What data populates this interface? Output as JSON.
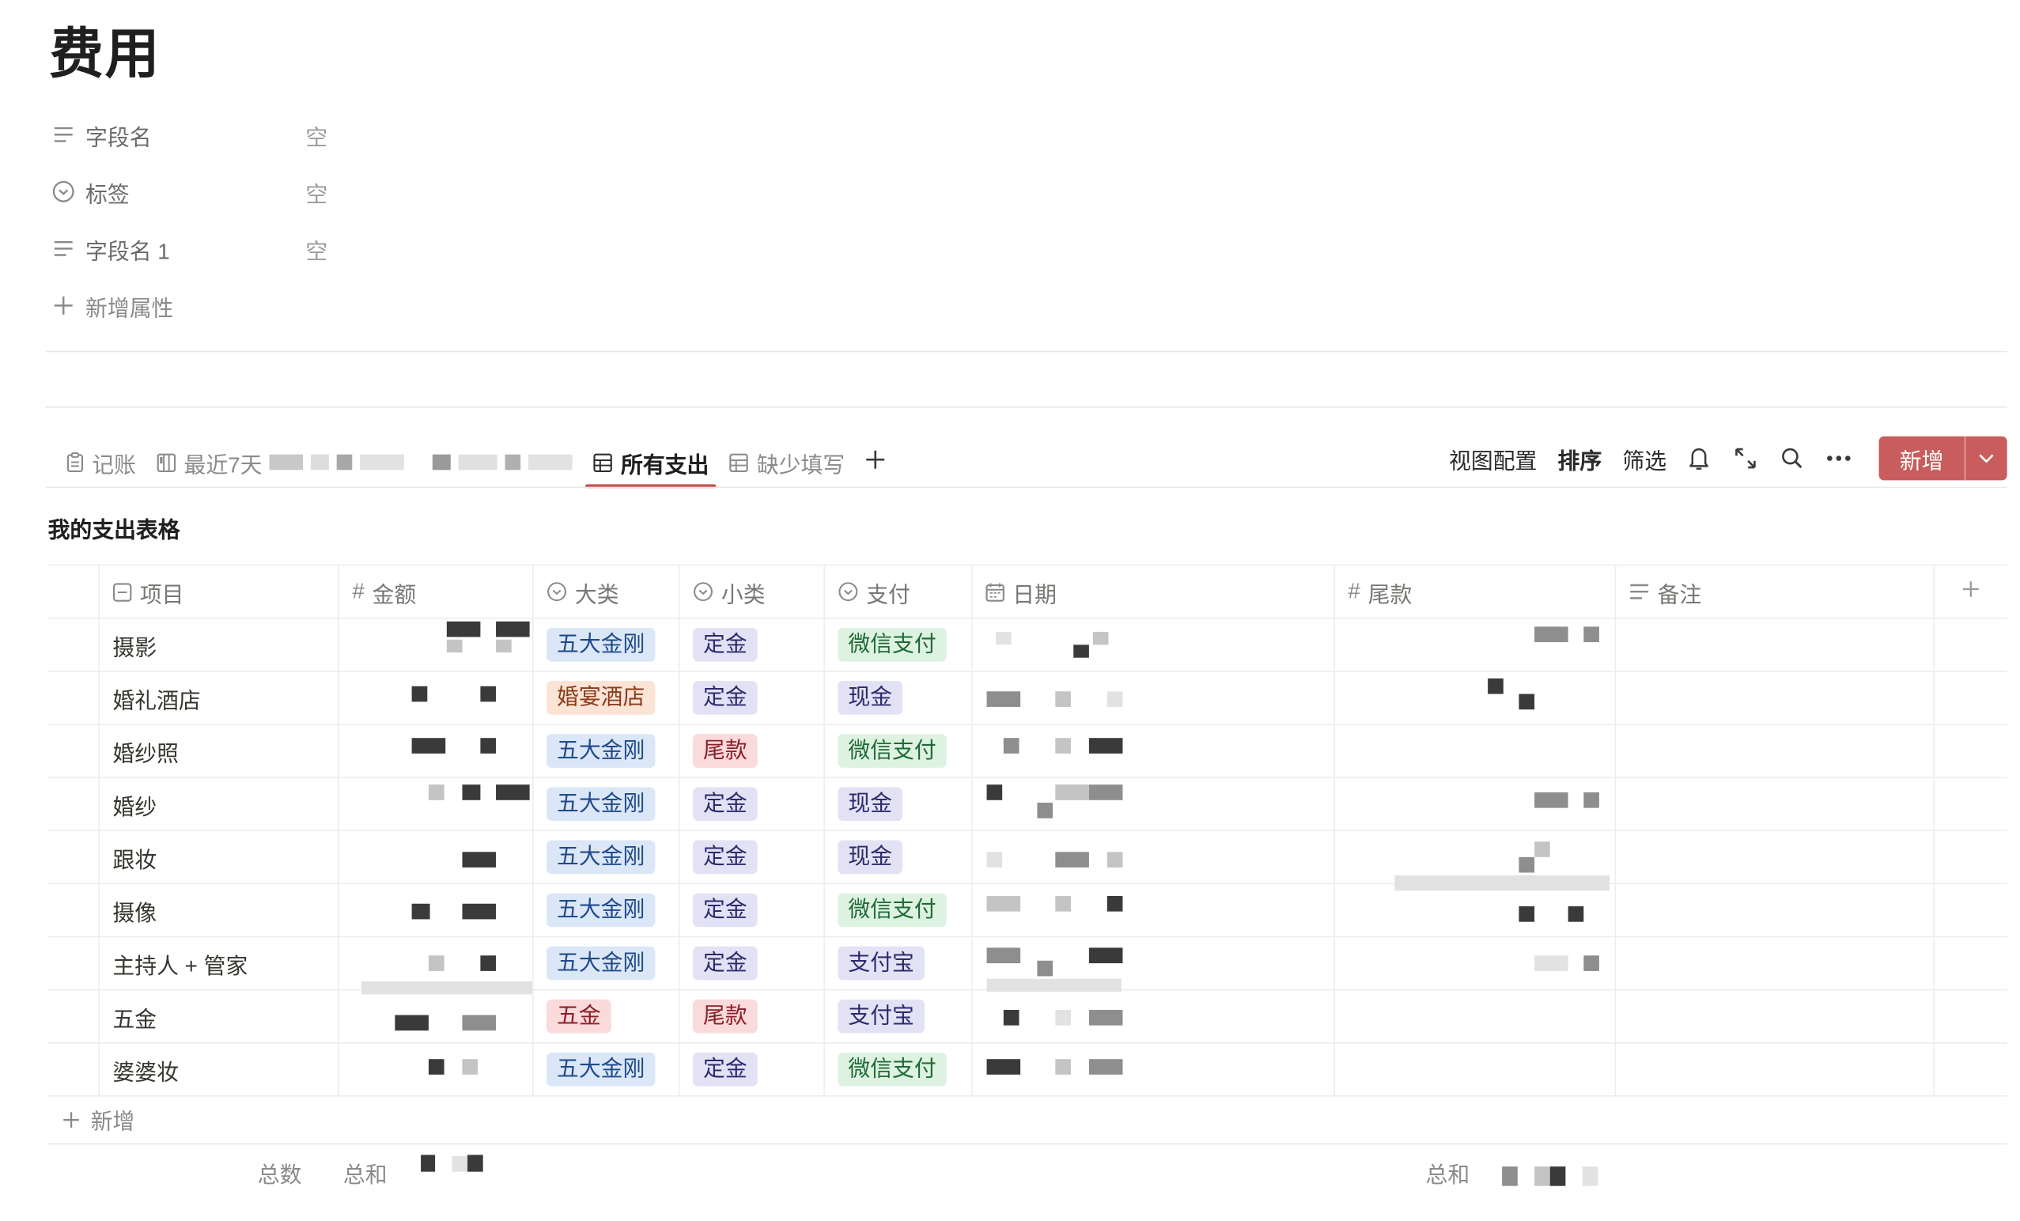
{
  "page": {
    "title": "费用"
  },
  "properties": [
    {
      "icon": "text-lines-icon",
      "name": "字段名",
      "value": "空"
    },
    {
      "icon": "select-circle-icon",
      "name": "标签",
      "value": "空"
    },
    {
      "icon": "text-lines-icon",
      "name": "字段名 1",
      "value": "空"
    }
  ],
  "add_property_label": "新增属性",
  "tabs": [
    {
      "label": "记账",
      "icon": "clipboard-icon",
      "active": false
    },
    {
      "label": "最近7天",
      "icon": "board-icon",
      "active": false
    },
    {
      "label": "所有支出",
      "icon": "table-icon",
      "active": true
    },
    {
      "label": "缺少填写",
      "icon": "table-icon",
      "active": false
    }
  ],
  "toolbar": {
    "view_config": "视图配置",
    "sort": "排序",
    "filter": "筛选",
    "new_label": "新增"
  },
  "view": {
    "title": "我的支出表格"
  },
  "columns": [
    {
      "label": "项目",
      "icon": "checkbox-square-icon"
    },
    {
      "label": "金额",
      "icon": "hash-icon"
    },
    {
      "label": "大类",
      "icon": "select-circle-icon"
    },
    {
      "label": "小类",
      "icon": "select-circle-icon"
    },
    {
      "label": "支付",
      "icon": "select-circle-icon"
    },
    {
      "label": "日期",
      "icon": "calendar-icon"
    },
    {
      "label": "尾款",
      "icon": "hash-icon"
    },
    {
      "label": "备注",
      "icon": "text-lines-icon"
    }
  ],
  "tag_colors": {
    "blue": {
      "bg": "#dbe7f7",
      "fg": "#1f4a8a"
    },
    "orange": {
      "bg": "#fbe4d6",
      "fg": "#8a3d1a"
    },
    "red": {
      "bg": "#fadada",
      "fg": "#8a1f2a"
    },
    "green": {
      "bg": "#def2e2",
      "fg": "#1f6a35"
    },
    "purple": {
      "bg": "#e3e2f5",
      "fg": "#2b2a6b"
    }
  },
  "rows": [
    {
      "item": "摄影",
      "category": "五大金刚",
      "category_color": "blue",
      "sub": "定金",
      "sub_color": "purple",
      "pay": "微信支付",
      "pay_color": "green"
    },
    {
      "item": "婚礼酒店",
      "category": "婚宴酒店",
      "category_color": "orange",
      "sub": "定金",
      "sub_color": "purple",
      "pay": "现金",
      "pay_color": "purple"
    },
    {
      "item": "婚纱照",
      "category": "五大金刚",
      "category_color": "blue",
      "sub": "尾款",
      "sub_color": "red",
      "pay": "微信支付",
      "pay_color": "green"
    },
    {
      "item": "婚纱",
      "category": "五大金刚",
      "category_color": "blue",
      "sub": "定金",
      "sub_color": "purple",
      "pay": "现金",
      "pay_color": "purple"
    },
    {
      "item": "跟妆",
      "category": "五大金刚",
      "category_color": "blue",
      "sub": "定金",
      "sub_color": "purple",
      "pay": "现金",
      "pay_color": "purple"
    },
    {
      "item": "摄像",
      "category": "五大金刚",
      "category_color": "blue",
      "sub": "定金",
      "sub_color": "purple",
      "pay": "微信支付",
      "pay_color": "green"
    },
    {
      "item": "主持人 + 管家",
      "category": "五大金刚",
      "category_color": "blue",
      "sub": "定金",
      "sub_color": "purple",
      "pay": "支付宝",
      "pay_color": "purple"
    },
    {
      "item": "五金",
      "category": "五金",
      "category_color": "red",
      "sub": "尾款",
      "sub_color": "red",
      "pay": "支付宝",
      "pay_color": "purple"
    },
    {
      "item": "婆婆妆",
      "category": "五大金刚",
      "category_color": "blue",
      "sub": "定金",
      "sub_color": "purple",
      "pay": "微信支付",
      "pay_color": "green"
    }
  ],
  "add_row_label": "新增",
  "footer": {
    "count_label": "总数",
    "sum_label": "总和",
    "sum_label_2": "总和"
  }
}
